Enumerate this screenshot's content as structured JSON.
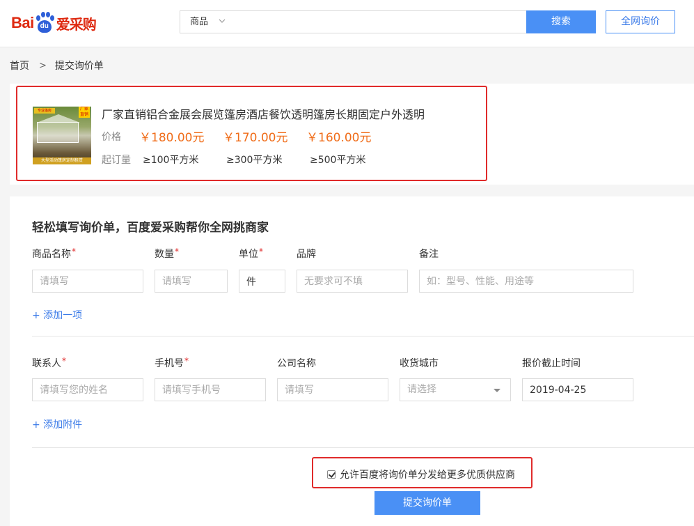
{
  "header": {
    "logo": {
      "bai": "Bai",
      "du": "du",
      "brand": "爱采购"
    },
    "search": {
      "category": "商品",
      "placeholder": "",
      "button": "搜索"
    },
    "inquiry_button": "全网询价"
  },
  "breadcrumb": {
    "home": "首页",
    "current": "提交询价单"
  },
  "product": {
    "title": "厂家直销铝合金展会展览篷房酒店餐饮透明篷房长期固定户外透明",
    "price_label": "价格",
    "prices": [
      "￥180.00元",
      "￥170.00元",
      "￥160.00元"
    ],
    "moq_label": "起订量",
    "moqs": [
      "≥100平方米",
      "≥300平方米",
      "≥500平方米"
    ],
    "image": {
      "top_left": "专业篷房",
      "top_right": "厂家直销",
      "banner": "大型活动篷房定制租赁"
    }
  },
  "form": {
    "title": "轻松填写询价单，百度爱采购帮你全网挑商家",
    "product_row": {
      "name": {
        "label": "商品名称",
        "placeholder": "请填写"
      },
      "qty": {
        "label": "数量",
        "placeholder": "请填写"
      },
      "unit": {
        "label": "单位",
        "value": "件"
      },
      "brand": {
        "label": "品牌",
        "placeholder": "无要求可不填"
      },
      "note": {
        "label": "备注",
        "placeholder": "如：型号、性能、用途等"
      }
    },
    "add_item": "+  添加一项",
    "contact_row": {
      "contact": {
        "label": "联系人",
        "placeholder": "请填写您的姓名"
      },
      "phone": {
        "label": "手机号",
        "placeholder": "请填写手机号"
      },
      "company": {
        "label": "公司名称",
        "placeholder": "请填写"
      },
      "city": {
        "label": "收货城市",
        "placeholder": "请选择"
      },
      "deadline": {
        "label": "报价截止时间",
        "value": "2019-04-25"
      }
    },
    "required_mark": "*",
    "add_attachment": "+ 添加附件",
    "consent": "允许百度将询价单分发给更多优质供应商",
    "submit": "提交询价单"
  },
  "colors": {
    "accent": "#4a90f5",
    "price": "#f06d1a",
    "highlight_border": "#e02b2b",
    "brand_red": "#de2910"
  }
}
